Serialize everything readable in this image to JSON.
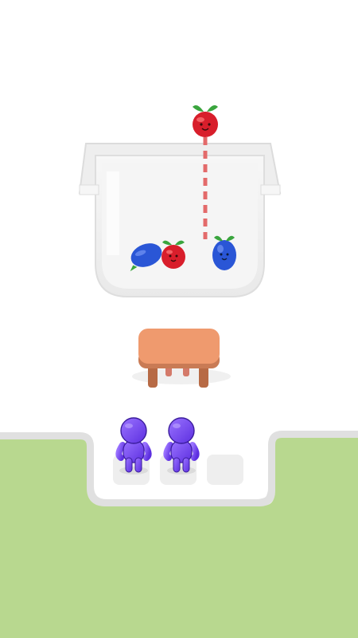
{
  "scene": {
    "colors": {
      "background": "#ffffff",
      "grass": "#b8d88f",
      "path_border": "#e3e3e3",
      "container": "#f0f0f0",
      "table_top": "#ef9a6e",
      "table_leg": "#b76a45",
      "fruit_red": "#d81e2b",
      "fruit_blue": "#2a56d6",
      "leaf_green": "#3aa53e",
      "character_purple": "#7b4cf0",
      "drop_line": "#e36a6a"
    },
    "container": {
      "fruits": [
        {
          "name": "red-fruit-icon"
        },
        {
          "name": "blue-fruit-icon"
        },
        {
          "name": "red-fruit-icon"
        },
        {
          "name": "blue-fruit-icon"
        }
      ]
    },
    "queue": {
      "slots_total": 3,
      "characters": [
        {
          "name": "purple-character"
        },
        {
          "name": "purple-character"
        }
      ]
    }
  }
}
